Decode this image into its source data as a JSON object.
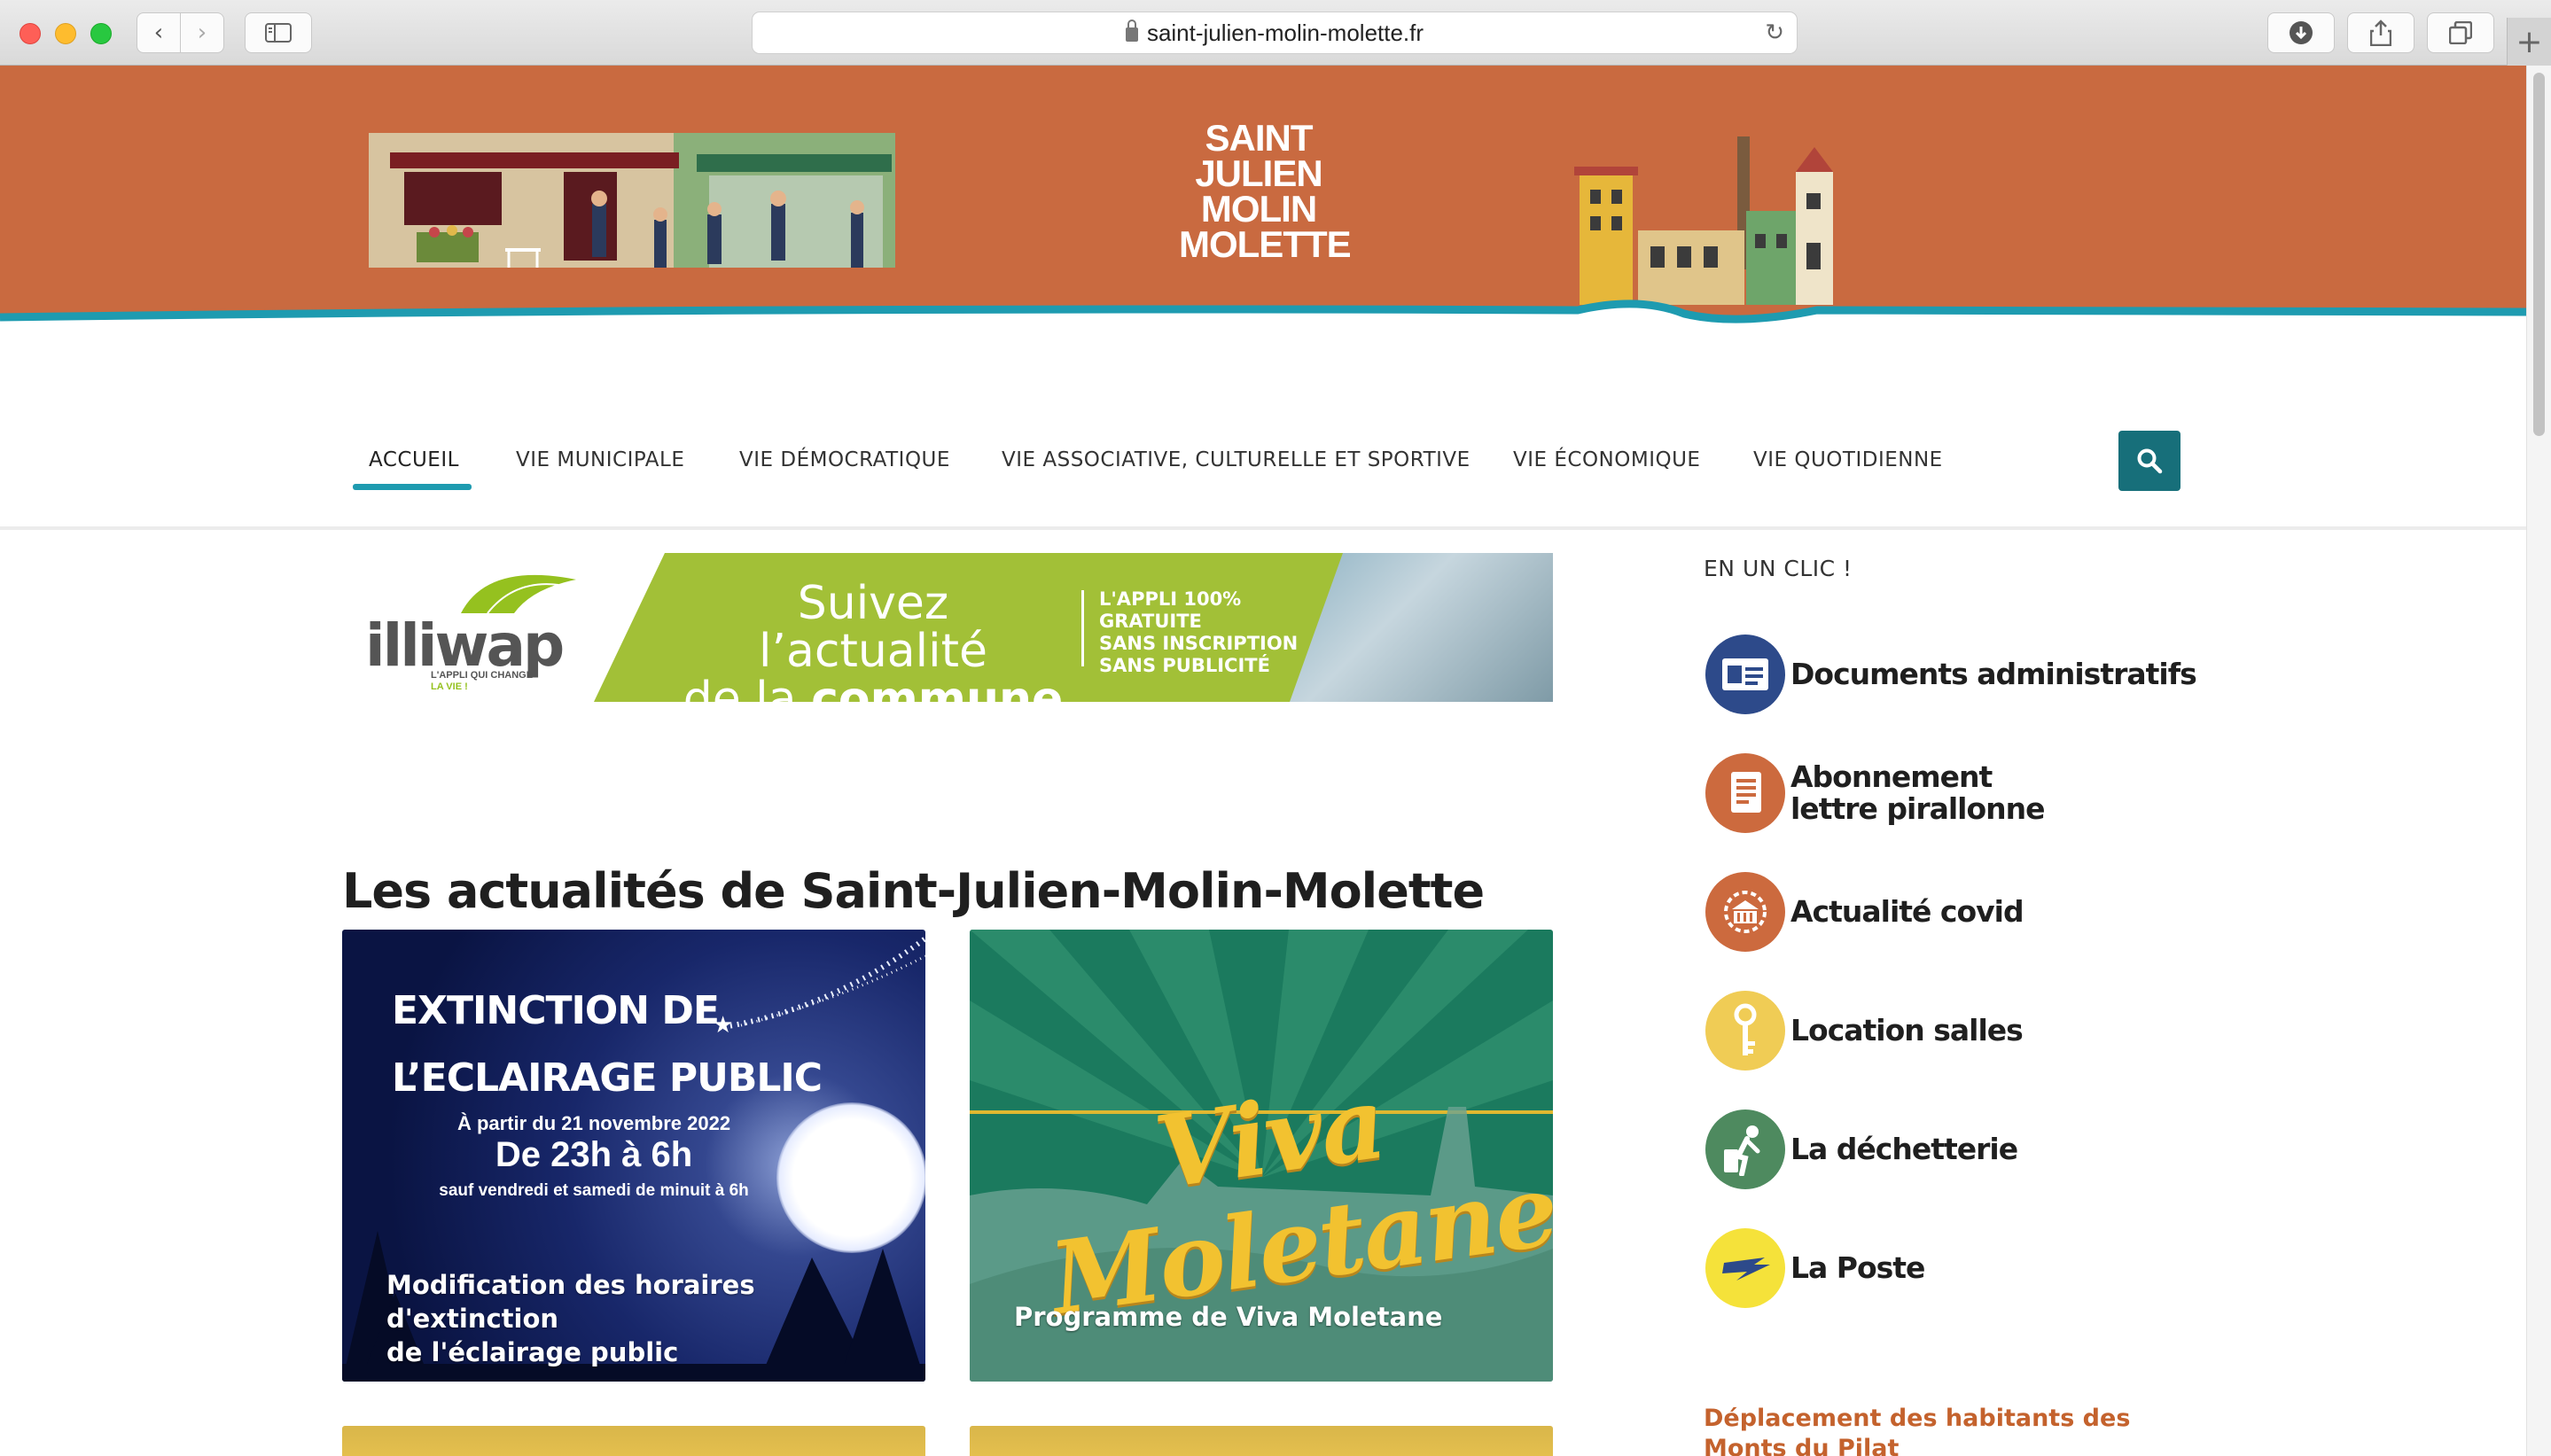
{
  "browser": {
    "url": "saint-julien-molin-molette.fr",
    "back_icon": "chevron-left-icon",
    "forward_icon": "chevron-right-icon"
  },
  "site": {
    "logo_lines": [
      "SAINT",
      "JULIEN",
      "MOLIN",
      "MOLETTE"
    ],
    "colors": {
      "banner": "#c96a40",
      "teal": "#1e9bb0",
      "search": "#176f7a"
    }
  },
  "nav": {
    "items": [
      {
        "label": "ACCUEIL"
      },
      {
        "label": "VIE MUNICIPALE"
      },
      {
        "label": "VIE DÉMOCRATIQUE"
      },
      {
        "label": "VIE ASSOCIATIVE, CULTURELLE ET SPORTIVE"
      },
      {
        "label": "VIE ÉCONOMIQUE"
      },
      {
        "label": "VIE QUOTIDIENNE"
      }
    ],
    "search_icon": "search-icon"
  },
  "illiwap": {
    "logo": "illiwap",
    "tagline_1": "L'APPLI QUI CHANGE",
    "tagline_2": "LA VIE !",
    "headline_1": "Suivez l’actualité",
    "headline_2a": "de la ",
    "headline_2b": "commune",
    "small_1": "L'APPLI 100%",
    "small_2": "GRATUITE",
    "small_3": "SANS INSCRIPTION",
    "small_4": "SANS PUBLICITÉ"
  },
  "main": {
    "title": "Les actualités de Saint-Julien-Molin-Molette"
  },
  "cards": [
    {
      "poster_title_1": "EXTINCTION DE",
      "poster_title_2": "L’ECLAIRAGE PUBLIC",
      "poster_date": "À partir du 21 novembre 2022",
      "poster_hours": "De 23h à 6h",
      "poster_note": "sauf vendredi et samedi de minuit à 6h",
      "caption_1": "Modification des horaires d'extinction",
      "caption_2": "de l'éclairage public"
    },
    {
      "poster_word_1": "Viva",
      "poster_word_2": "Moletane",
      "caption_1": "Programme de Viva Moletane"
    }
  ],
  "sidebar": {
    "heading": "EN UN CLIC !",
    "links": [
      {
        "label_1": "Documents administratifs",
        "label_2": "",
        "icon": "id-card-icon",
        "color": "#2d4a8a"
      },
      {
        "label_1": "Abonnement",
        "label_2": "lettre pirallonne",
        "icon": "newspaper-icon",
        "color": "#cc6a3e"
      },
      {
        "label_1": "Actualité covid",
        "label_2": "",
        "icon": "virus-building-icon",
        "color": "#cc6a3e"
      },
      {
        "label_1": "Location salles",
        "label_2": "",
        "icon": "key-icon",
        "color": "#f0cc55"
      },
      {
        "label_1": "La déchetterie",
        "label_2": "",
        "icon": "recycling-person-icon",
        "color": "#4e8a5f"
      },
      {
        "label_1": "La Poste",
        "label_2": "",
        "icon": "la-poste-icon",
        "color": "#f5e23a"
      }
    ],
    "deplacement": "Déplacement des habitants des Monts du Pilat"
  }
}
